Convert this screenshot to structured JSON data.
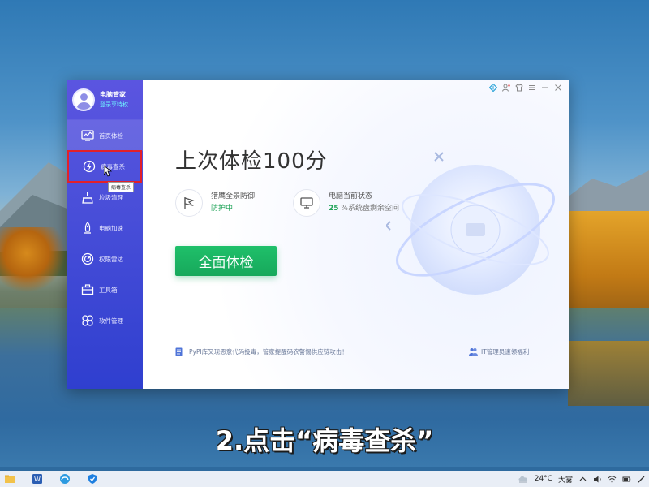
{
  "app": {
    "profile": {
      "name": "电脑管家",
      "login": "登录享特权"
    },
    "nav": [
      {
        "id": "home",
        "label": "首页体检",
        "icon": "monitor-icon"
      },
      {
        "id": "virus",
        "label": "病毒查杀",
        "icon": "bolt-shield-icon"
      },
      {
        "id": "clean",
        "label": "垃圾清理",
        "icon": "broom-icon"
      },
      {
        "id": "speed",
        "label": "电脑加速",
        "icon": "rocket-icon"
      },
      {
        "id": "permission",
        "label": "权限雷达",
        "icon": "radar-icon"
      },
      {
        "id": "toolbox",
        "label": "工具箱",
        "icon": "toolbox-icon"
      },
      {
        "id": "software",
        "label": "软件管理",
        "icon": "apps-icon"
      }
    ],
    "tooltip": "病毒查杀",
    "headline": "上次体检100分",
    "stat_protect": {
      "title": "猎鹰全景防御",
      "value": "防护中"
    },
    "stat_status": {
      "title": "电脑当前状态",
      "value_num": "25",
      "value_rest": "%系统盘剩余空间"
    },
    "scan_button": "全面体检",
    "news": "PyPI库又现恶意代码投毒，管家提醒码农警惕供应链攻击！",
    "it_link": "IT管理员速领福利"
  },
  "caption": "2.点击“病毒查杀”",
  "taskbar": {
    "temperature": "24°C",
    "weather": "大雾"
  }
}
